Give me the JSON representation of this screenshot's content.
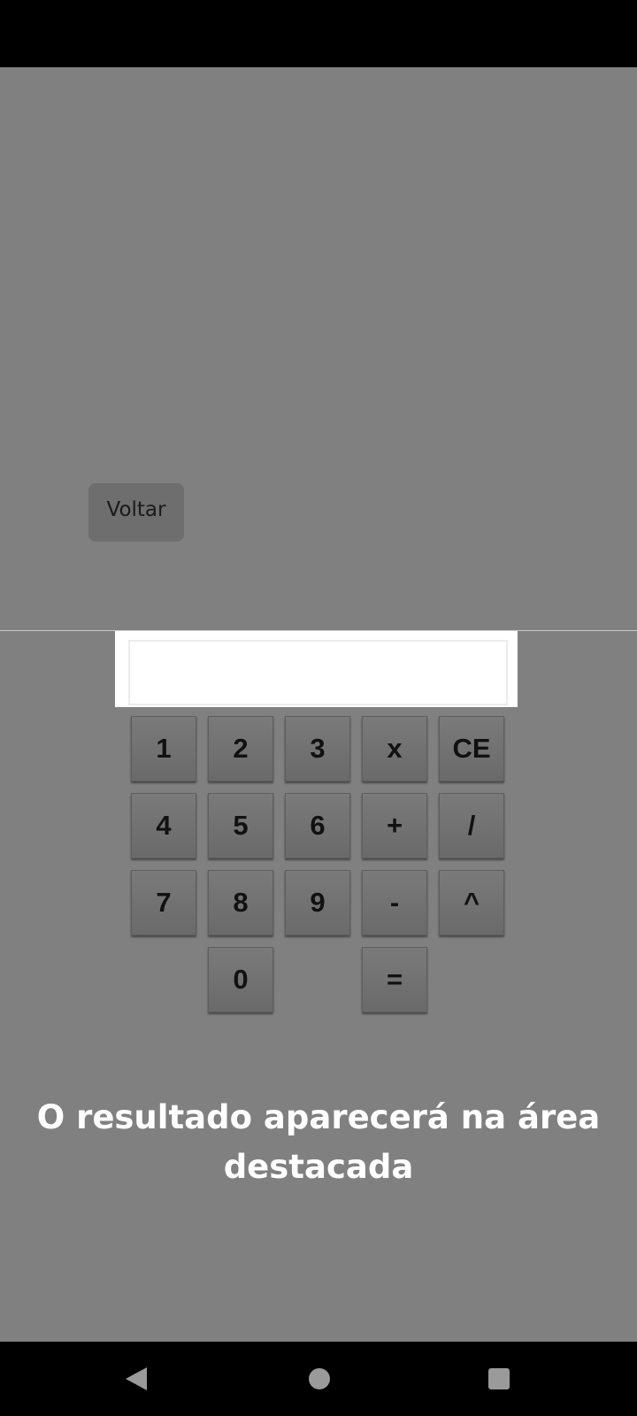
{
  "back_button": {
    "label": "Voltar"
  },
  "display": {
    "value": ""
  },
  "keypad": {
    "row1": [
      "1",
      "2",
      "3",
      "x",
      "CE"
    ],
    "row2": [
      "4",
      "5",
      "6",
      "+",
      "/"
    ],
    "row3": [
      "7",
      "8",
      "9",
      "-",
      "^"
    ],
    "row4": [
      "0",
      "="
    ]
  },
  "message": {
    "line1": "O resultado aparecerá na área",
    "line2": "destacada"
  },
  "nav_bar": {
    "icons": [
      "back-triangle-icon",
      "home-circle-icon",
      "recents-square-icon"
    ]
  },
  "colors": {
    "background": "#808080",
    "key_face": "#727272",
    "display_background": "#ffffff",
    "message_text": "#ffffff",
    "system_bars": "#000000"
  }
}
